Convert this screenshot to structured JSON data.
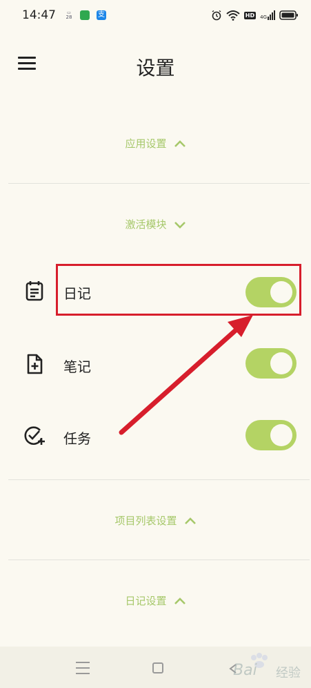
{
  "status_bar": {
    "time": "14:47",
    "calendar_day": "28",
    "alipay_char": "支",
    "hd_label": "HD",
    "signal_label": "4G",
    "icons": [
      "calendar-icon",
      "message-icon",
      "alipay-icon",
      "alarm-icon",
      "wifi-icon",
      "hd-icon",
      "signal-icon",
      "battery-icon"
    ]
  },
  "header": {
    "title": "设置",
    "menu_icon": "menu-icon"
  },
  "sections": {
    "app_settings": "应用设置",
    "activate_modules": "激活模块",
    "project_list_settings": "项目列表设置",
    "diary_settings": "日记设置"
  },
  "modules": [
    {
      "label": "日记",
      "icon": "diary-icon",
      "enabled": true
    },
    {
      "label": "笔记",
      "icon": "note-add-icon",
      "enabled": true
    },
    {
      "label": "任务",
      "icon": "task-add-icon",
      "enabled": true
    }
  ],
  "colors": {
    "accent": "#b4d364",
    "section_text": "#a6c86a",
    "background": "#fbf9f1",
    "highlight": "#d71e2c"
  },
  "watermark": {
    "brand": "Bai",
    "suffix": "经验"
  }
}
